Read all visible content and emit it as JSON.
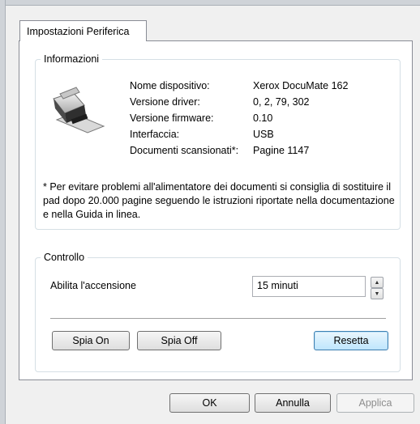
{
  "tab": {
    "label": "Impostazioni Periferica"
  },
  "info": {
    "legend": "Informazioni",
    "device_icon": "scanner-icon",
    "rows": [
      {
        "label": "Nome dispositivo:",
        "value": "Xerox DocuMate 162"
      },
      {
        "label": "Versione driver:",
        "value": "0, 2, 79, 302"
      },
      {
        "label": "Versione firmware:",
        "value": "0.10"
      },
      {
        "label": "Interfaccia:",
        "value": "USB"
      },
      {
        "label": "Documenti scansionati*:",
        "value": "Pagine 1147"
      }
    ],
    "note": "* Per evitare problemi all'alimentatore dei documenti si consiglia di sostituire il pad dopo 20.000 pagine seguendo le istruzioni riportate nella documentazione e nella Guida in linea."
  },
  "control": {
    "legend": "Controllo",
    "power_label": "Abilita l'accensione",
    "power_value": "15 minuti",
    "lamp_on": "Spia On",
    "lamp_off": "Spia Off",
    "reset": "Resetta"
  },
  "footer": {
    "ok": "OK",
    "cancel": "Annulla",
    "apply": "Applica"
  }
}
